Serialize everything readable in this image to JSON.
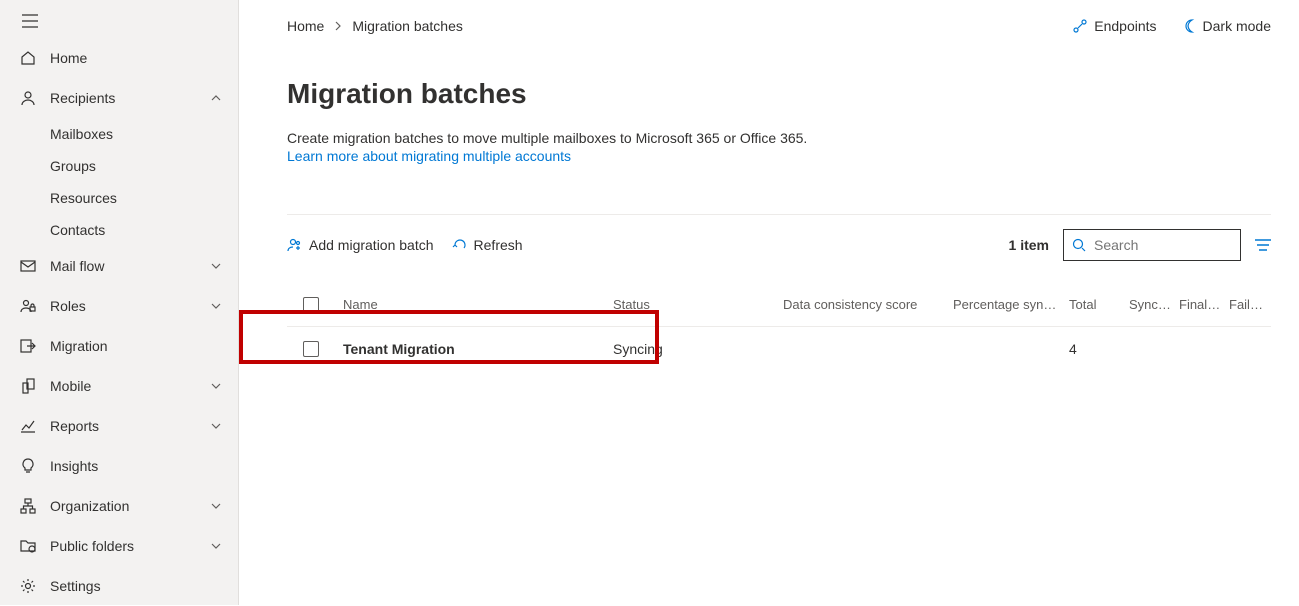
{
  "breadcrumb": {
    "home": "Home",
    "current": "Migration batches"
  },
  "top_actions": {
    "endpoints": "Endpoints",
    "darkmode": "Dark mode"
  },
  "sidebar": {
    "items": [
      {
        "label": "Home"
      },
      {
        "label": "Recipients"
      },
      {
        "label": "Mail flow"
      },
      {
        "label": "Roles"
      },
      {
        "label": "Migration"
      },
      {
        "label": "Mobile"
      },
      {
        "label": "Reports"
      },
      {
        "label": "Insights"
      },
      {
        "label": "Organization"
      },
      {
        "label": "Public folders"
      },
      {
        "label": "Settings"
      }
    ],
    "sub_recipients": [
      {
        "label": "Mailboxes"
      },
      {
        "label": "Groups"
      },
      {
        "label": "Resources"
      },
      {
        "label": "Contacts"
      }
    ]
  },
  "page": {
    "title": "Migration batches",
    "description": "Create migration batches to move multiple mailboxes to Microsoft 365 or Office 365.",
    "learn_more": "Learn more about migrating multiple accounts"
  },
  "toolbar": {
    "add": "Add migration batch",
    "refresh": "Refresh",
    "count": "1 item",
    "search_placeholder": "Search"
  },
  "table": {
    "headers": {
      "name": "Name",
      "status": "Status",
      "dcs": "Data consistency score",
      "pct": "Percentage synced",
      "total": "Total",
      "synced": "Synced",
      "finalized": "Finalized",
      "failed": "Failed"
    },
    "rows": [
      {
        "name": "Tenant Migration",
        "status": "Syncing",
        "dcs": "",
        "pct": "",
        "total": "4",
        "synced": "",
        "finalized": "",
        "failed": ""
      }
    ]
  }
}
